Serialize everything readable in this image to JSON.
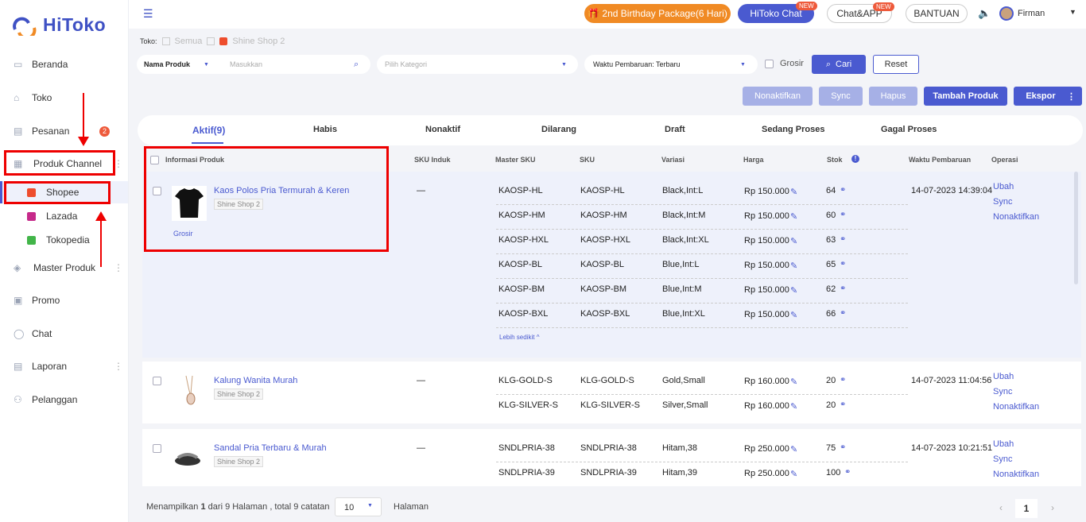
{
  "brand": {
    "name": "HiToko"
  },
  "sidebar": {
    "items": [
      {
        "label": "Beranda",
        "icon": "home-icon"
      },
      {
        "label": "Toko",
        "icon": "store-icon"
      },
      {
        "label": "Pesanan",
        "icon": "order-icon",
        "badge": "2"
      },
      {
        "label": "Produk Channel",
        "icon": "grid-icon"
      },
      {
        "label": "Master Produk",
        "icon": "box-icon"
      },
      {
        "label": "Promo",
        "icon": "promo-icon"
      },
      {
        "label": "Chat",
        "icon": "chat-icon"
      },
      {
        "label": "Laporan",
        "icon": "report-icon"
      },
      {
        "label": "Pelanggan",
        "icon": "users-icon"
      }
    ],
    "subitems": [
      {
        "label": "Shopee",
        "color": "#ee4d2d"
      },
      {
        "label": "Lazada",
        "color": "#c62a8a"
      },
      {
        "label": "Tokopedia",
        "color": "#42b549"
      }
    ]
  },
  "topbar": {
    "birthday": "🎁 2nd Birthday Package(6 Hari)",
    "hitoko_chat": "HiToko Chat",
    "chat_app": "Chat&APP",
    "bantuan": "BANTUAN",
    "new_tag": "NEW",
    "user": "Firman"
  },
  "toko": {
    "label": "Toko:",
    "semua": "Semua",
    "shop": "Shine Shop 2"
  },
  "filters": {
    "field": "Nama Produk",
    "search_placeholder": "Masukkan",
    "kategori": "Pilih Kategori",
    "waktu": "Waktu Pembaruan: Terbaru",
    "grosir": "Grosir",
    "cari": "Cari",
    "reset": "Reset"
  },
  "actions": {
    "nonaktifkan": "Nonaktifkan",
    "sync": "Sync",
    "hapus": "Hapus",
    "tambah": "Tambah Produk",
    "ekspor": "Ekspor"
  },
  "tabs": [
    "Aktif(9)",
    "Habis",
    "Nonaktif",
    "Dilarang",
    "Draft",
    "Sedang Proses",
    "Gagal Proses"
  ],
  "columns": [
    "Informasi Produk",
    "SKU Induk",
    "Master SKU",
    "SKU",
    "Variasi",
    "Harga",
    "Stok",
    "Waktu Pembaruan",
    "Operasi"
  ],
  "products": [
    {
      "name": "Kaos Polos Pria Termurah & Keren",
      "shop": "Shine Shop 2",
      "tag": "Grosir",
      "sku_induk": "—",
      "updated": "14-07-2023 14:39:04",
      "ops": [
        "Ubah",
        "Sync",
        "Nonaktifkan"
      ],
      "toggle": "Lebih sedikit ^",
      "variants": [
        {
          "master": "KAOSP-HL",
          "sku": "KAOSP-HL",
          "var": "Black,Int:L",
          "price": "Rp 150.000",
          "stock": "64"
        },
        {
          "master": "KAOSP-HM",
          "sku": "KAOSP-HM",
          "var": "Black,Int:M",
          "price": "Rp 150.000",
          "stock": "60"
        },
        {
          "master": "KAOSP-HXL",
          "sku": "KAOSP-HXL",
          "var": "Black,Int:XL",
          "price": "Rp 150.000",
          "stock": "63"
        },
        {
          "master": "KAOSP-BL",
          "sku": "KAOSP-BL",
          "var": "Blue,Int:L",
          "price": "Rp 150.000",
          "stock": "65"
        },
        {
          "master": "KAOSP-BM",
          "sku": "KAOSP-BM",
          "var": "Blue,Int:M",
          "price": "Rp 150.000",
          "stock": "62"
        },
        {
          "master": "KAOSP-BXL",
          "sku": "KAOSP-BXL",
          "var": "Blue,Int:XL",
          "price": "Rp 150.000",
          "stock": "66"
        }
      ]
    },
    {
      "name": "Kalung Wanita Murah",
      "shop": "Shine Shop 2",
      "sku_induk": "—",
      "updated": "14-07-2023 11:04:56",
      "ops": [
        "Ubah",
        "Sync",
        "Nonaktifkan"
      ],
      "variants": [
        {
          "master": "KLG-GOLD-S",
          "sku": "KLG-GOLD-S",
          "var": "Gold,Small",
          "price": "Rp 160.000",
          "stock": "20"
        },
        {
          "master": "KLG-SILVER-S",
          "sku": "KLG-SILVER-S",
          "var": "Silver,Small",
          "price": "Rp 160.000",
          "stock": "20"
        }
      ]
    },
    {
      "name": "Sandal Pria Terbaru & Murah",
      "shop": "Shine Shop 2",
      "sku_induk": "—",
      "updated": "14-07-2023 10:21:51",
      "ops": [
        "Ubah",
        "Sync",
        "Nonaktifkan"
      ],
      "variants": [
        {
          "master": "SNDLPRIA-38",
          "sku": "SNDLPRIA-38",
          "var": "Hitam,38",
          "price": "Rp 250.000",
          "stock": "75"
        },
        {
          "master": "SNDLPRIA-39",
          "sku": "SNDLPRIA-39",
          "var": "Hitam,39",
          "price": "Rp 250.000",
          "stock": "100"
        }
      ]
    }
  ],
  "footer": {
    "summary_prefix": "Menampilkan ",
    "current": "1",
    "summary_mid": " dari 9 Halaman , total 9 catatan",
    "per_page": "10",
    "halaman": "Halaman",
    "page": "1"
  }
}
